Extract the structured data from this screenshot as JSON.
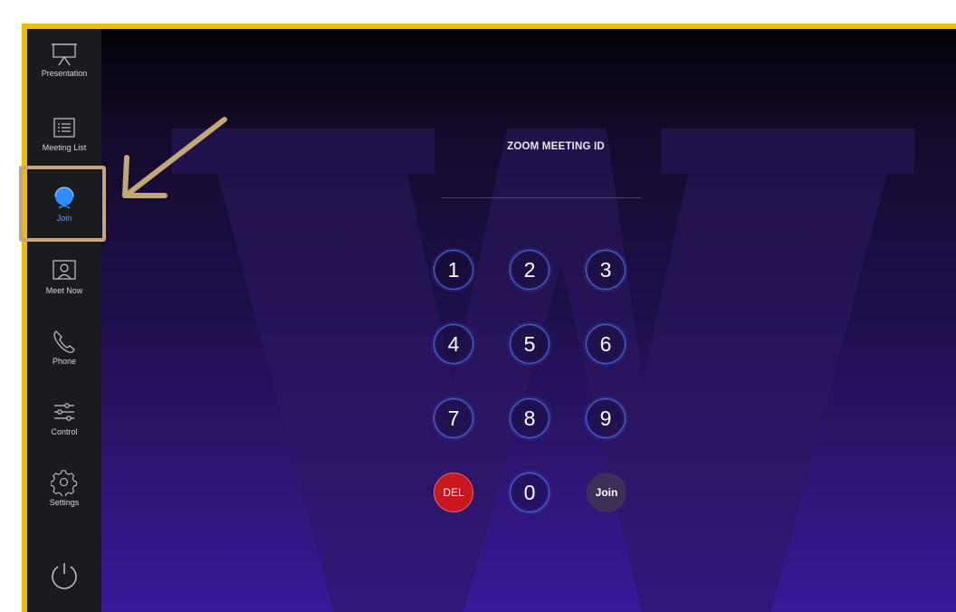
{
  "sidebar": {
    "items": [
      {
        "label": "Presentation",
        "icon": "presentation-icon"
      },
      {
        "label": "Meeting List",
        "icon": "meeting-list-icon"
      },
      {
        "label": "Join",
        "icon": "join-icon"
      },
      {
        "label": "Meet Now",
        "icon": "meet-now-icon"
      },
      {
        "label": "Phone",
        "icon": "phone-icon"
      },
      {
        "label": "Control",
        "icon": "control-icon"
      },
      {
        "label": "Settings",
        "icon": "settings-icon"
      },
      {
        "label": "",
        "icon": "power-icon"
      }
    ]
  },
  "main": {
    "title": "ZOOM MEETING ID",
    "keypad": [
      "1",
      "2",
      "3",
      "4",
      "5",
      "6",
      "7",
      "8",
      "9",
      "DEL",
      "0",
      "Join"
    ]
  },
  "colors": {
    "frame": "#f1bc00",
    "annotation": "#c3a877",
    "key_ring": "#4a6fe0",
    "delete": "#c8171f",
    "join": "#3c2f58"
  }
}
